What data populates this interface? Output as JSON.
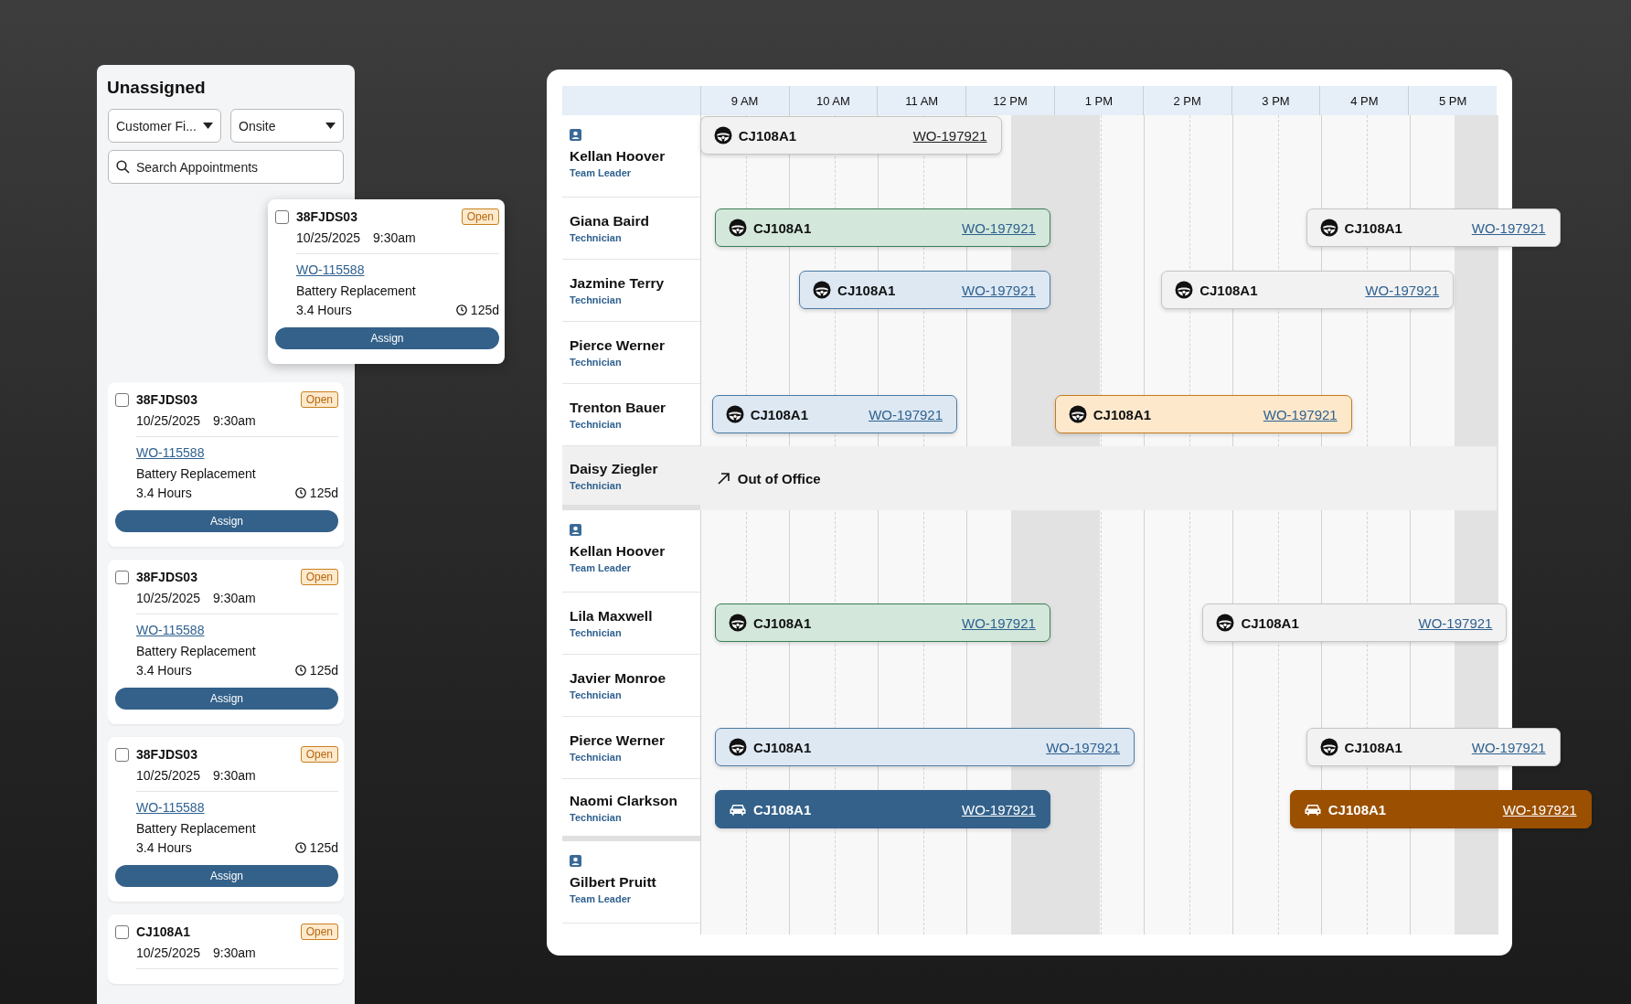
{
  "panel": {
    "title": "Unassigned",
    "filters": [
      {
        "value": "Customer Fi..."
      },
      {
        "value": "Onsite"
      }
    ],
    "search": {
      "placeholder": "Search Appointments"
    },
    "dragged_card": {
      "code": "38FJDS03",
      "checked": false,
      "status": "Open",
      "date": "10/25/2025",
      "time": "9:30am",
      "work_order": "WO-115588",
      "task": "Battery Replacement",
      "duration": "3.4 Hours",
      "age": "125d",
      "button": "Assign"
    },
    "cards": [
      {
        "code": "38FJDS03",
        "checked": false,
        "status": "Open",
        "date": "10/25/2025",
        "time": "9:30am",
        "work_order": "WO-115588",
        "task": "Battery Replacement",
        "duration": "3.4 Hours",
        "age": "125d",
        "button": "Assign"
      },
      {
        "code": "38FJDS03",
        "checked": false,
        "status": "Open",
        "date": "10/25/2025",
        "time": "9:30am",
        "work_order": "WO-115588",
        "task": "Battery Replacement",
        "duration": "3.4 Hours",
        "age": "125d",
        "button": "Assign"
      },
      {
        "code": "38FJDS03",
        "checked": false,
        "status": "Open",
        "date": "10/25/2025",
        "time": "9:30am",
        "work_order": "WO-115588",
        "task": "Battery Replacement",
        "duration": "3.4 Hours",
        "age": "125d",
        "button": "Assign"
      },
      {
        "code": "CJ108A1",
        "checked": false,
        "status": "Open",
        "date": "10/25/2025",
        "time": "9:30am"
      }
    ]
  },
  "schedule": {
    "hours": [
      "9 AM",
      "10 AM",
      "11 AM",
      "12 PM",
      "1 PM",
      "2 PM",
      "3 PM",
      "4 PM",
      "5 PM"
    ],
    "groups": [
      {
        "rows": [
          {
            "name": "Kellan Hoover",
            "role": "Team Leader",
            "kind": "leader",
            "appointments": [
              {
                "kind": "muted",
                "code": "CJ108A1",
                "work_order": "WO-197921"
              }
            ]
          },
          {
            "name": "Giana Baird",
            "role": "Technician",
            "kind": "technician",
            "appointments": [
              {
                "kind": "green",
                "code": "CJ108A1",
                "work_order": "WO-197921"
              },
              {
                "kind": "neutral",
                "code": "CJ108A1",
                "work_order": "WO-197921"
              }
            ]
          },
          {
            "name": "Jazmine Terry",
            "role": "Technician",
            "kind": "technician",
            "appointments": [
              {
                "kind": "blue",
                "code": "CJ108A1",
                "work_order": "WO-197921"
              },
              {
                "kind": "neutral",
                "code": "CJ108A1",
                "work_order": "WO-197921"
              }
            ]
          },
          {
            "name": "Pierce Werner",
            "role": "Technician",
            "kind": "technician",
            "appointments": []
          },
          {
            "name": "Trenton Bauer",
            "role": "Technician",
            "kind": "technician",
            "appointments": [
              {
                "kind": "blue",
                "code": "CJ108A1",
                "work_order": "WO-197921"
              },
              {
                "kind": "amber",
                "code": "CJ108A1",
                "work_order": "WO-197921"
              }
            ]
          },
          {
            "name": "Daisy Ziegler",
            "role": "Technician",
            "kind": "out",
            "status": "Out of Office"
          }
        ]
      },
      {
        "rows": [
          {
            "name": "Kellan Hoover",
            "role": "Team Leader",
            "kind": "leader",
            "appointments": []
          },
          {
            "name": "Lila Maxwell",
            "role": "Technician",
            "kind": "technician",
            "appointments": [
              {
                "kind": "green",
                "code": "CJ108A1",
                "work_order": "WO-197921"
              },
              {
                "kind": "neutral",
                "code": "CJ108A1",
                "work_order": "WO-197921"
              }
            ]
          },
          {
            "name": "Javier Monroe",
            "role": "Technician",
            "kind": "technician",
            "appointments": []
          },
          {
            "name": "Pierce Werner",
            "role": "Technician",
            "kind": "technician",
            "appointments": [
              {
                "kind": "blue",
                "code": "CJ108A1",
                "work_order": "WO-197921"
              },
              {
                "kind": "neutral",
                "code": "CJ108A1",
                "work_order": "WO-197921"
              }
            ]
          },
          {
            "name": "Naomi Clarkson",
            "role": "Technician",
            "kind": "technician",
            "appointments": [
              {
                "kind": "dark-blue",
                "code": "CJ108A1",
                "work_order": "WO-197921"
              },
              {
                "kind": "dark-amber",
                "code": "CJ108A1",
                "work_order": "WO-197921"
              }
            ]
          }
        ]
      },
      {
        "rows": [
          {
            "name": "Gilbert Pruitt",
            "role": "Team Leader",
            "kind": "leader",
            "appointments": []
          }
        ]
      }
    ]
  }
}
